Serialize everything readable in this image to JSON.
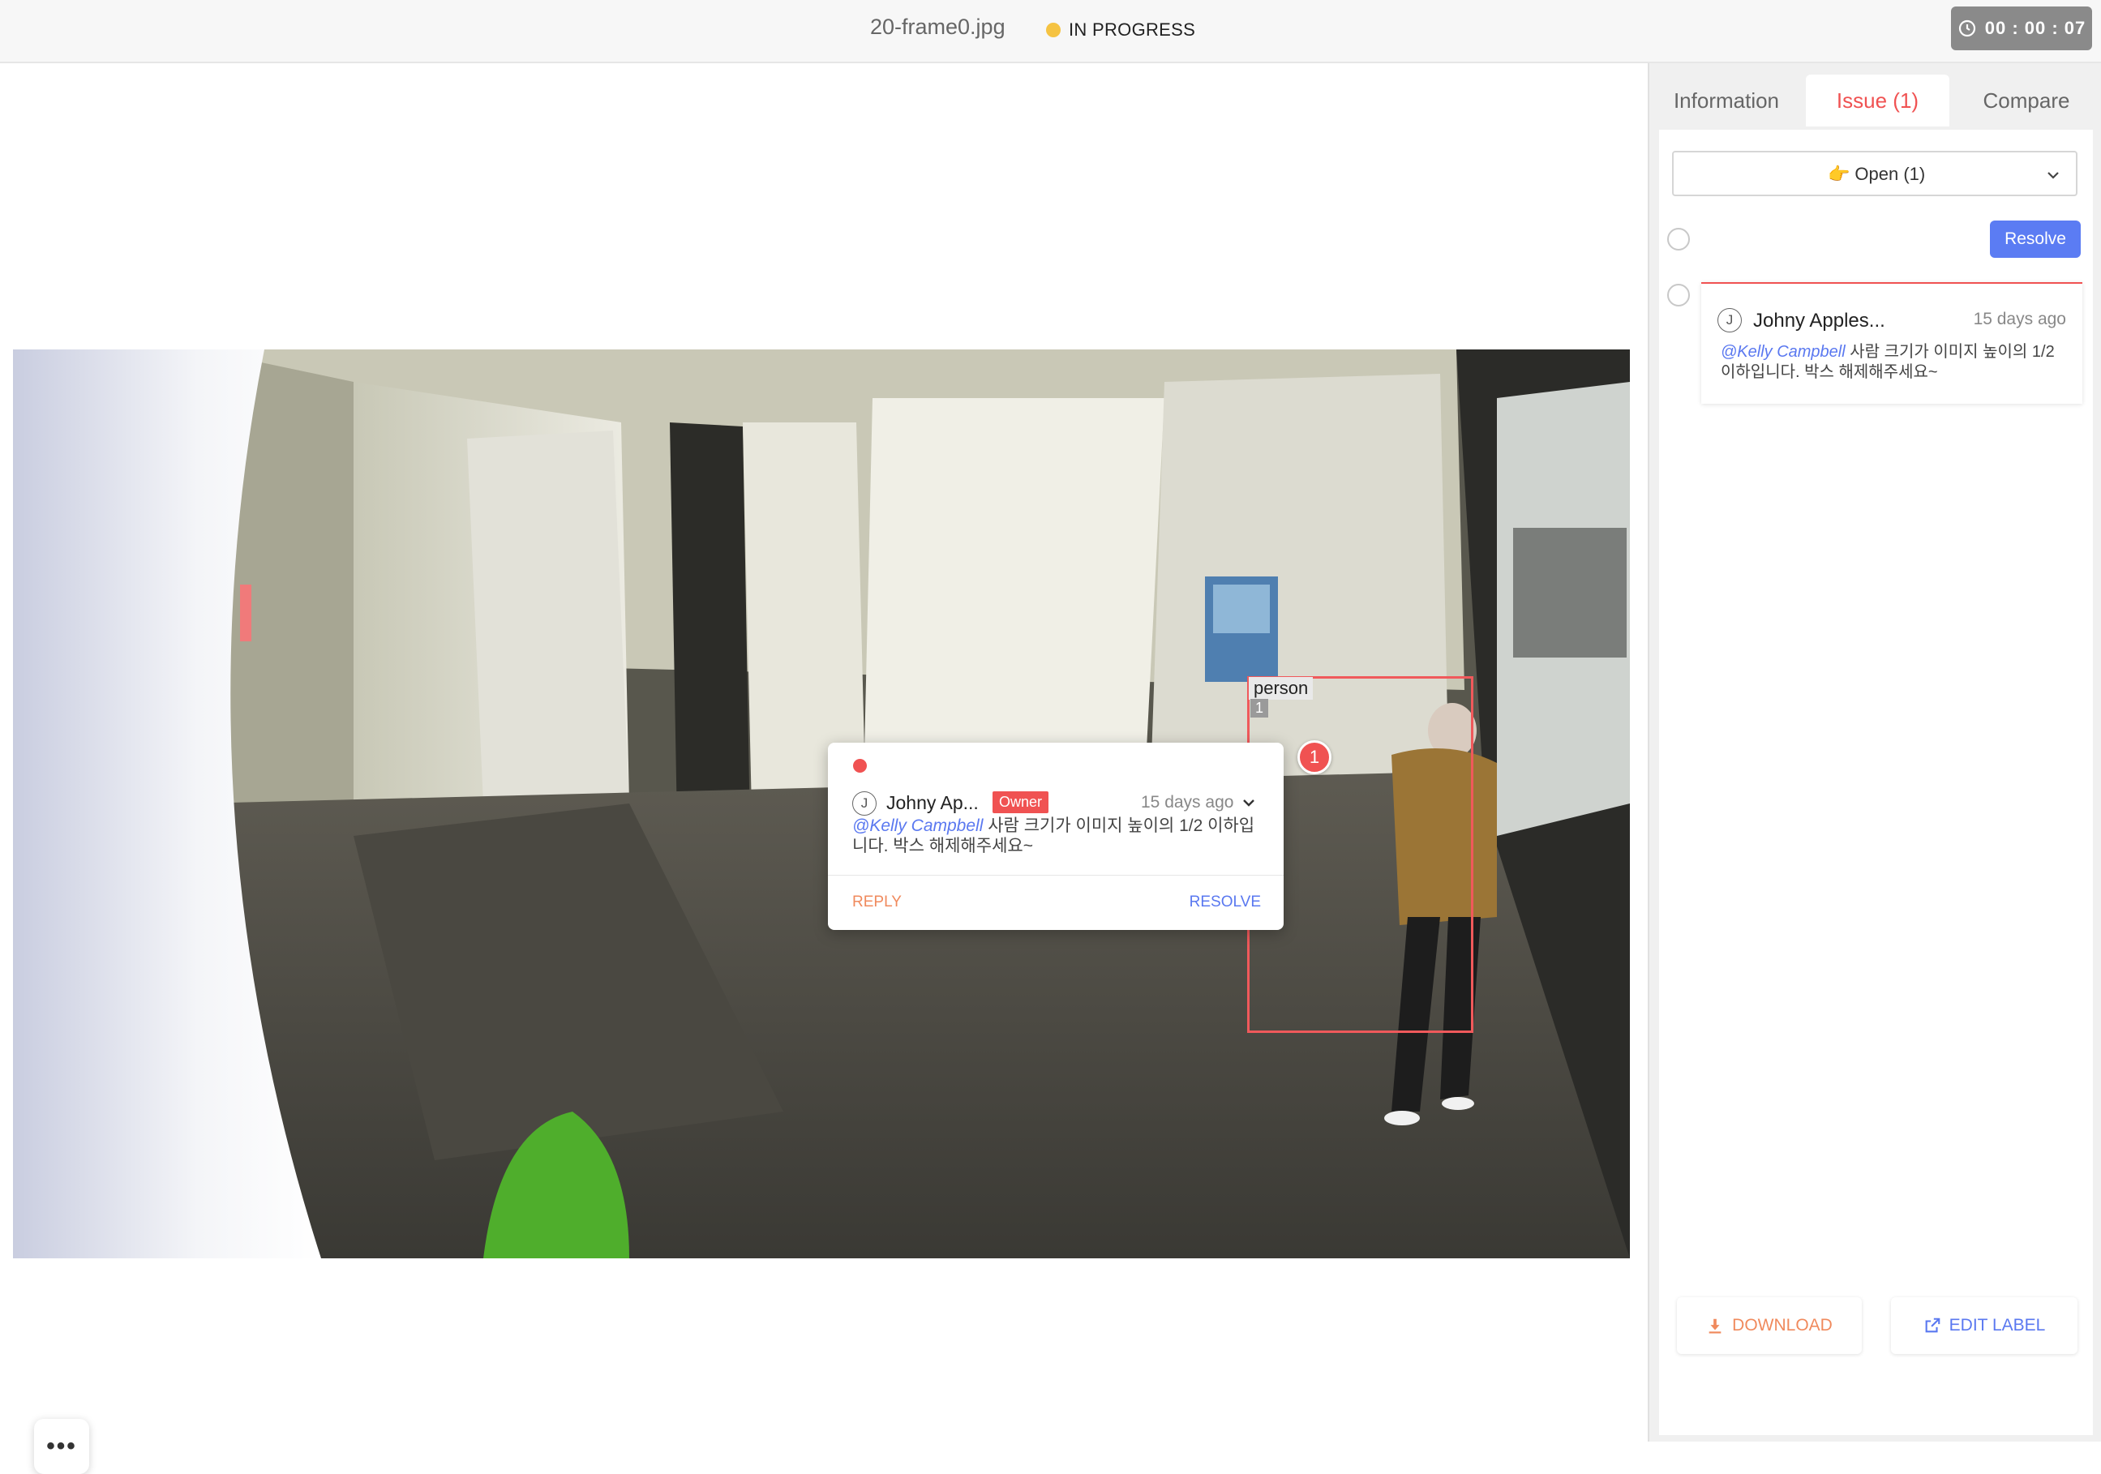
{
  "header": {
    "file_name": "20-frame0.jpg",
    "status": "IN PROGRESS",
    "timer": "00 : 00 : 07"
  },
  "annotation": {
    "class_label": "person",
    "index": "1",
    "issue_marker": "1"
  },
  "popup": {
    "author_initial": "J",
    "author": "Johny Ap...",
    "role_badge": "Owner",
    "time": "15 days ago",
    "mention": "@Kelly Campbell",
    "message": " 사람 크기가 이미지 높이의 1/2 이하입니다. 박스 해제해주세요~",
    "reply_label": "REPLY",
    "resolve_label": "RESOLVE"
  },
  "panel": {
    "tabs": {
      "information": "Information",
      "issue": "Issue (1)",
      "compare": "Compare"
    },
    "filter": {
      "emoji": "👉",
      "value": "Open (1)"
    },
    "resolve_button": "Resolve",
    "issue_card": {
      "author_initial": "J",
      "author": "Johny Apples...",
      "time": "15 days ago",
      "mention": "@Kelly Campbell",
      "message": " 사람 크기가 이미지 높이의 1/2 이하입니다. 박스 해제해주세요~"
    },
    "download_label": "DOWNLOAD",
    "edit_label": "EDIT LABEL"
  },
  "more_button": "•••",
  "colors": {
    "accent_red": "#f05252",
    "accent_blue": "#5b7cf3",
    "accent_orange": "#f08a5d",
    "status_yellow": "#f5c342"
  }
}
